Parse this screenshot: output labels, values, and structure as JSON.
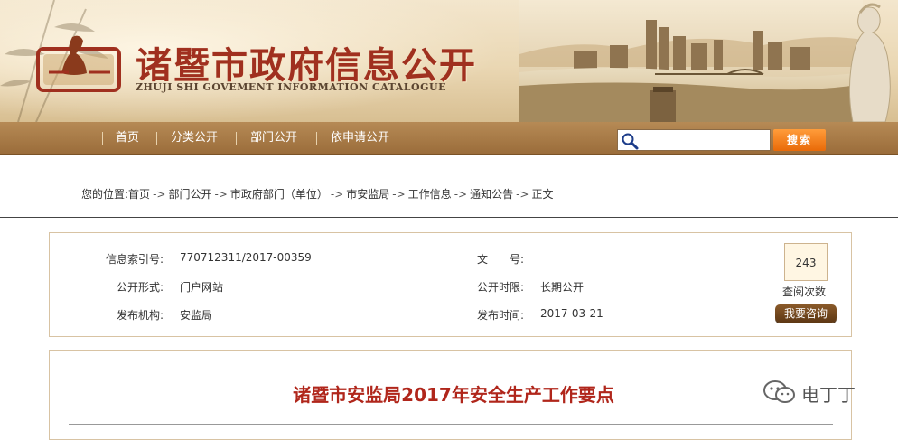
{
  "header": {
    "title_cn": "诸暨市政府信息公开",
    "title_en": "ZHUJI SHI GOVEMENT INFORMATION CATALOGUE"
  },
  "nav": {
    "items": [
      "首页",
      "分类公开",
      "部门公开",
      "依申请公开"
    ],
    "search_placeholder": "",
    "search_button": "搜索"
  },
  "breadcrumb": {
    "prefix": "您的位置:",
    "items": [
      "首页",
      "部门公开",
      "市政府部门（单位）",
      "市安监局",
      "工作信息",
      "通知公告",
      "正文"
    ],
    "separator": "->"
  },
  "info": {
    "index_label": "信息索引号:",
    "index_value": "770712311/2017-00359",
    "form_label": "公开形式:",
    "form_value": "门户网站",
    "org_label": "发布机构:",
    "org_value": "安监局",
    "docno_label": "文　　号:",
    "docno_value": "",
    "period_label": "公开时限:",
    "period_value": "长期公开",
    "date_label": "发布时间:",
    "date_value": "2017-03-21",
    "view_count": "243",
    "view_count_label": "查阅次数",
    "consult_button": "我要咨询"
  },
  "article": {
    "title": "诸暨市安监局2017年安全生产工作要点"
  },
  "watermark": {
    "text": "电丁丁"
  }
}
